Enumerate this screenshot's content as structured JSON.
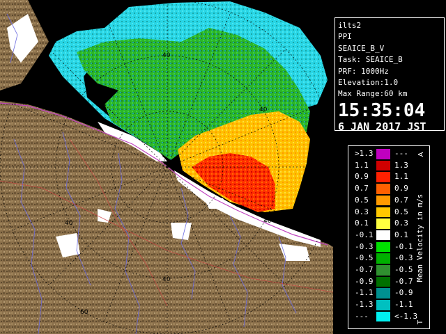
{
  "map": {
    "range_labels": [
      "40",
      "60",
      "40",
      "60",
      "40",
      "40",
      "40",
      "60"
    ],
    "colors": {
      "sea_dark": "#000000",
      "land": "#8a6f4a",
      "land_dark": "#5e4a2e",
      "land_light": "#b59b72",
      "cyan": "#29d6e6",
      "teal": "#1aa8a8",
      "green": "#2ab52a",
      "yellow": "#ffd400",
      "orange": "#ff8a00",
      "red": "#e60000",
      "white": "#ffffff",
      "coast": "#c044c0",
      "river": "#5a5ad8"
    }
  },
  "info": {
    "station": "ilts2",
    "product": "PPI",
    "scan": "SEAICE_B_V",
    "task": "Task: SEAICE_B",
    "prf": "PRF: 1000Hz",
    "elevation": "Elevation:1.0",
    "max_range": "Max Range:60 km",
    "time": "15:35:04",
    "date": "6 JAN 2017 JST"
  },
  "legend": {
    "title": "Mean Velocity in m/s",
    "top_mark": "A",
    "bottom_mark": "T",
    "rows": [
      {
        "lo": ">1.3",
        "hi": "---",
        "color": "#c000c0"
      },
      {
        "lo": "1.1",
        "hi": "1.3",
        "color": "#d00000"
      },
      {
        "lo": "0.9",
        "hi": "1.1",
        "color": "#ff2000"
      },
      {
        "lo": "0.7",
        "hi": "0.9",
        "color": "#ff6000"
      },
      {
        "lo": "0.5",
        "hi": "0.7",
        "color": "#ff9a00"
      },
      {
        "lo": "0.3",
        "hi": "0.5",
        "color": "#ffc800"
      },
      {
        "lo": "0.1",
        "hi": "0.3",
        "color": "#ffff40"
      },
      {
        "lo": "-0.1",
        "hi": "0.1",
        "color": "#ffffff"
      },
      {
        "lo": "-0.3",
        "hi": "-0.1",
        "color": "#00e000"
      },
      {
        "lo": "-0.5",
        "hi": "-0.3",
        "color": "#00b000"
      },
      {
        "lo": "-0.7",
        "hi": "-0.5",
        "color": "#309030"
      },
      {
        "lo": "-0.9",
        "hi": "-0.7",
        "color": "#007000"
      },
      {
        "lo": "-1.1",
        "hi": "-0.9",
        "color": "#009090"
      },
      {
        "lo": "-1.3",
        "hi": "-1.1",
        "color": "#00c0c0"
      },
      {
        "lo": "---",
        "hi": "<-1.3",
        "color": "#00f0f0"
      }
    ]
  }
}
